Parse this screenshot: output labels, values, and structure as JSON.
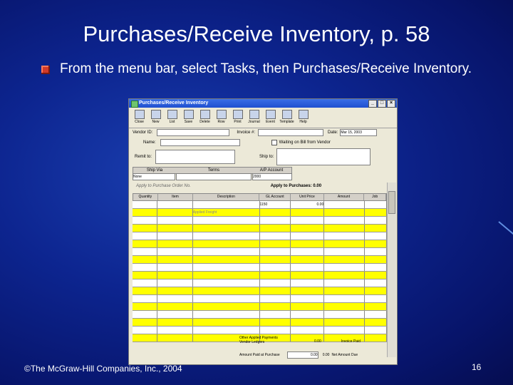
{
  "slide": {
    "title": "Purchases/Receive Inventory, p. 58",
    "bullet": "From the menu bar, select Tasks, then Purchases/Receive Inventory.",
    "footer_left": "©The McGraw-Hill Companies, Inc., 2004",
    "page_number": "16"
  },
  "window": {
    "title": "Purchases/Receive Inventory",
    "toolbar": [
      "Close",
      "New",
      "List",
      "Save",
      "Delete",
      "Row",
      "Print",
      "Journal",
      "Event",
      "Template",
      "Help"
    ],
    "labels": {
      "vendor_id": "Vendor ID:",
      "invoice": "Invoice #:",
      "date_label": "Date:",
      "date_value": "Mar 15, 2003",
      "name": "Name:",
      "waiting": "Waiting on Bill from Vendor",
      "remit_to": "Remit to:",
      "ship_to": "Ship to:",
      "ship_via": "Ship Via",
      "terms": "Terms",
      "ap_account": "A/P Account",
      "ship_via_value": "None",
      "ap_account_value": "2000",
      "apply_po": "Apply to Purchase Order No.",
      "apply_purchases": "Apply to Purchases: 0.00",
      "applied_freight": "Applied Freight",
      "other_costs_1": "Other Applied Payments",
      "other_costs_2": "Vendor Ledgers",
      "invoice_paid": "Invoice Paid",
      "amount_paid": "Amount Paid at Purchase",
      "net_due": "Net Amount Due",
      "zero": "0.00"
    },
    "columns": [
      "Quantity",
      "Item",
      "Description",
      "GL Account",
      "Unit Price",
      "Amount",
      "Job"
    ],
    "first_row": {
      "gl": "1150",
      "price": "0.00"
    }
  }
}
